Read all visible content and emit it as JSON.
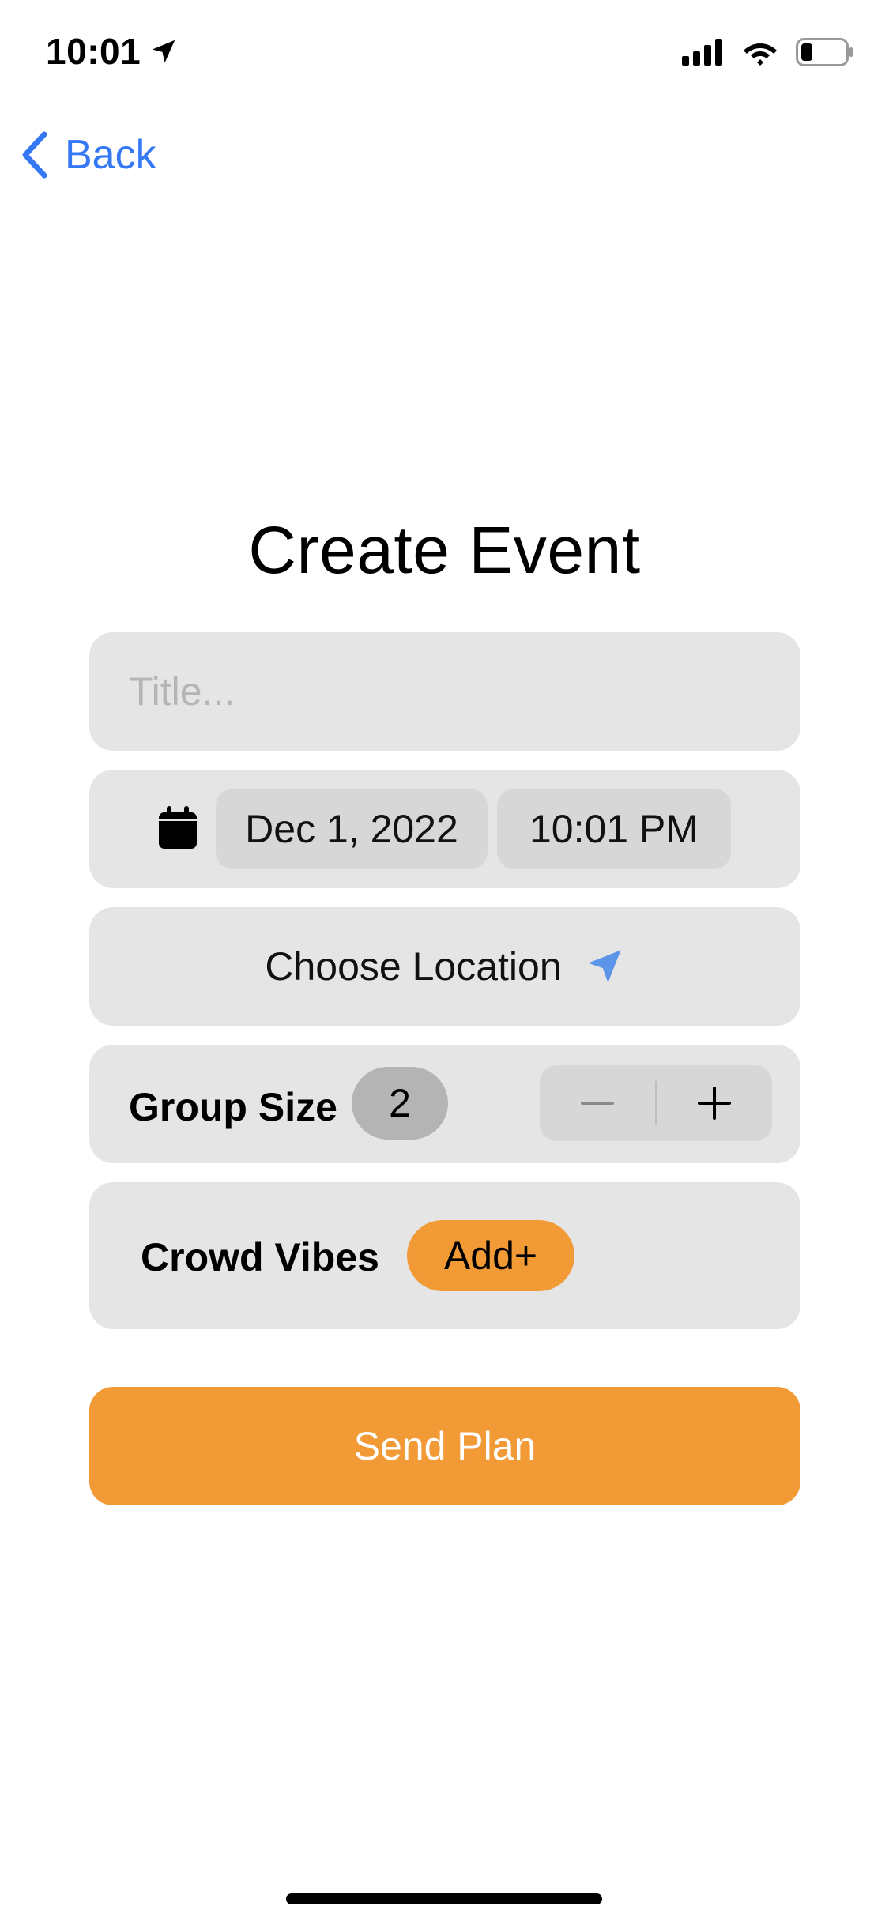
{
  "status_bar": {
    "time": "10:01",
    "icons": [
      "location-arrow-icon",
      "cellular-signal-icon",
      "wifi-icon",
      "battery-icon"
    ]
  },
  "nav": {
    "back_label": "Back",
    "back_icon": "chevron-left-icon"
  },
  "page": {
    "title": "Create Event"
  },
  "form": {
    "title_input": {
      "value": "",
      "placeholder": "Title..."
    },
    "date": {
      "icon": "calendar-icon",
      "date_value": "Dec 1, 2022",
      "time_value": "10:01 PM"
    },
    "location": {
      "label": "Choose Location",
      "icon": "location-arrow-icon"
    },
    "group_size": {
      "label": "Group Size",
      "value": "2",
      "decrement_icon": "minus-icon",
      "increment_icon": "plus-icon"
    },
    "crowd_vibes": {
      "label": "Crowd Vibes",
      "add_label": "Add+"
    },
    "submit_label": "Send Plan"
  },
  "colors": {
    "accent_blue": "#3478f6",
    "accent_orange": "#f19a36",
    "card_background": "#e5e5e5",
    "pill_background": "#d7d7d7",
    "count_badge": "#b4b4b4",
    "location_icon": "#5b94e8"
  }
}
